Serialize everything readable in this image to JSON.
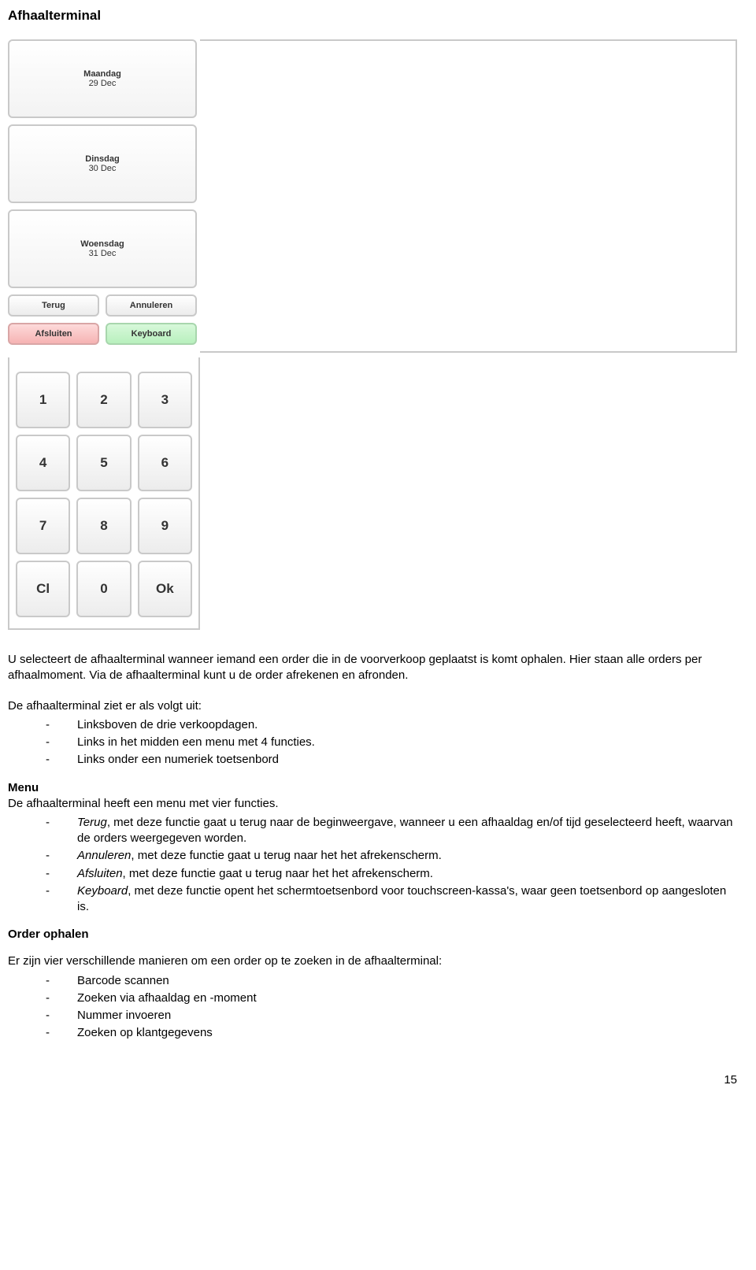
{
  "title": "Afhaalterminal",
  "days": [
    {
      "name": "Maandag",
      "date": "29 Dec"
    },
    {
      "name": "Dinsdag",
      "date": "30 Dec"
    },
    {
      "name": "Woensdag",
      "date": "31 Dec"
    }
  ],
  "buttons": {
    "terug": "Terug",
    "annuleren": "Annuleren",
    "afsluiten": "Afsluiten",
    "keyboard": "Keyboard"
  },
  "keypad": [
    "1",
    "2",
    "3",
    "4",
    "5",
    "6",
    "7",
    "8",
    "9",
    "Cl",
    "0",
    "Ok"
  ],
  "content": {
    "p1": "U selecteert de afhaalterminal wanneer iemand een order die in de voorverkoop geplaatst is komt ophalen. Hier staan alle orders per afhaalmoment. Via de afhaalterminal kunt u de order afrekenen en afronden.",
    "p2": "De afhaalterminal ziet er als volgt uit:",
    "ziet_list": [
      "Linksboven de drie verkoopdagen.",
      "Links in het midden een menu met 4 functies.",
      "Links onder een numeriek toetsenbord"
    ],
    "menu_head": "Menu",
    "menu_intro": "De afhaalterminal heeft een menu met vier functies.",
    "menu_items": [
      {
        "term": "Terug",
        "rest": ", met deze functie gaat u terug naar de beginweergave, wanneer u een afhaaldag en/of tijd geselecteerd heeft, waarvan de orders weergegeven worden."
      },
      {
        "term": "Annuleren",
        "rest": ", met deze functie gaat u terug naar het het afrekenscherm."
      },
      {
        "term": "Afsluiten",
        "rest": ", met deze functie gaat u terug naar het het afrekenscherm."
      },
      {
        "term": "Keyboard",
        "rest": ", met deze functie opent het schermtoetsenbord voor touchscreen-kassa's, waar geen toetsenbord op aangesloten is."
      }
    ],
    "order_head": "Order ophalen",
    "order_intro": "Er zijn vier verschillende manieren om een order op te zoeken in de afhaalterminal:",
    "order_list": [
      "Barcode scannen",
      "Zoeken via afhaaldag en -moment",
      "Nummer invoeren",
      "Zoeken op klantgegevens"
    ]
  },
  "page": "15"
}
